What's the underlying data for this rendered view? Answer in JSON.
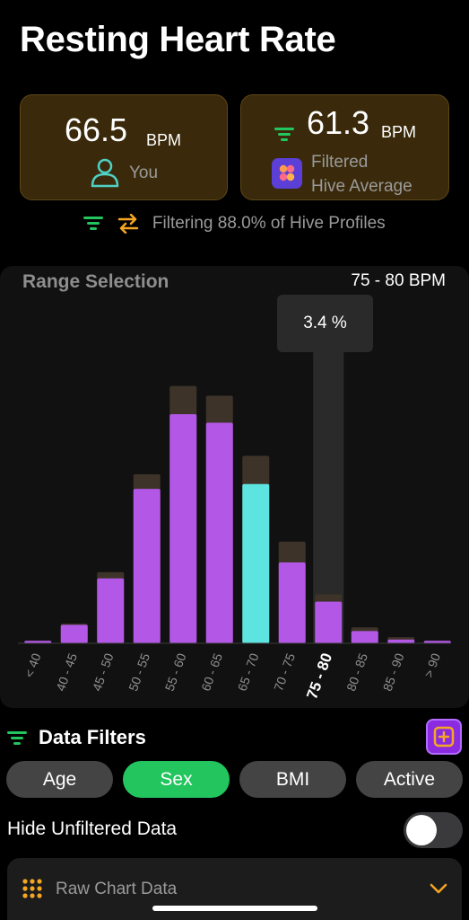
{
  "page": {
    "title": "Resting Heart Rate"
  },
  "you_card": {
    "value": "66.5",
    "unit": "BPM",
    "label": "You",
    "icon": "person-icon"
  },
  "hive_card": {
    "value": "61.3",
    "unit": "BPM",
    "label_line1": "Filtered",
    "label_line2": "Hive Average",
    "icon": "hive-app-icon"
  },
  "filter_summary": {
    "text": "Filtering 88.0% of Hive Profiles",
    "icons": [
      "filter-lines-icon",
      "swap-arrows-icon"
    ]
  },
  "range_selection": {
    "title": "Range Selection",
    "selected_range": "75 - 80 BPM",
    "tooltip": "3.4 %"
  },
  "chart_data": {
    "type": "bar",
    "categories": [
      "< 40",
      "40 - 45",
      "45 - 50",
      "50 - 55",
      "55 - 60",
      "60 - 65",
      "65 - 70",
      "70 - 75",
      "75 - 80",
      "80 - 85",
      "85 - 90",
      "> 90"
    ],
    "series": [
      {
        "values": [
          0.2,
          1.5,
          5.3,
          12.6,
          18.7,
          18.0,
          13.0,
          6.6,
          3.4,
          1.0,
          0.3,
          0.2
        ]
      },
      {
        "values": [
          0.2,
          1.6,
          5.8,
          13.8,
          21.0,
          20.2,
          15.3,
          8.3,
          4.0,
          1.3,
          0.5,
          0.2
        ]
      }
    ],
    "highlight_index": 6,
    "selected_index": 8,
    "ylim": [
      0,
      22
    ],
    "colors": {
      "filtered": "#b257e6",
      "unfiltered": "#3e3329",
      "highlight": "#5de3e0",
      "selected_band": "#2a2a2a"
    }
  },
  "data_filters": {
    "title": "Data Filters",
    "chips": [
      {
        "label": "Age",
        "active": false
      },
      {
        "label": "Sex",
        "active": true
      },
      {
        "label": "BMI",
        "active": false
      },
      {
        "label": "Active",
        "active": false
      }
    ]
  },
  "hide_unfiltered": {
    "label": "Hide Unfiltered Data",
    "on": false
  },
  "raw_chart_data": {
    "label": "Raw Chart Data",
    "icon": "grid-dots-icon"
  },
  "colors": {
    "accent_orange": "#f5a623",
    "accent_green": "#22c55e",
    "card_bg": "#3a2a0b",
    "purple": "#8a2be2"
  }
}
